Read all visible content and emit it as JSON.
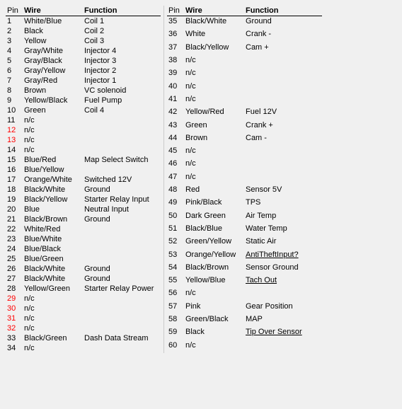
{
  "table_left": {
    "headers": [
      "Pin",
      "Wire",
      "Function"
    ],
    "rows": [
      {
        "pin": "1",
        "wire": "White/Blue",
        "function": "Coil 1",
        "pin_style": "",
        "function_style": ""
      },
      {
        "pin": "2",
        "wire": "Black",
        "function": "Coil 2",
        "pin_style": "",
        "function_style": ""
      },
      {
        "pin": "3",
        "wire": "Yellow",
        "function": "Coil 3",
        "pin_style": "",
        "function_style": ""
      },
      {
        "pin": "4",
        "wire": "Gray/White",
        "function": "Injector 4",
        "pin_style": "",
        "function_style": ""
      },
      {
        "pin": "5",
        "wire": "Gray/Black",
        "function": "Injector 3",
        "pin_style": "",
        "function_style": ""
      },
      {
        "pin": "6",
        "wire": "Gray/Yellow",
        "function": "Injector 2",
        "pin_style": "",
        "function_style": ""
      },
      {
        "pin": "7",
        "wire": "Gray/Red",
        "function": "Injector 1",
        "pin_style": "",
        "function_style": ""
      },
      {
        "pin": "8",
        "wire": "Brown",
        "function": "VC solenoid",
        "pin_style": "",
        "function_style": ""
      },
      {
        "pin": "9",
        "wire": "Yellow/Black",
        "function": "Fuel Pump",
        "pin_style": "",
        "function_style": ""
      },
      {
        "pin": "10",
        "wire": "Green",
        "function": "Coil 4",
        "pin_style": "",
        "function_style": ""
      },
      {
        "pin": "11",
        "wire": "n/c",
        "function": "",
        "pin_style": "",
        "function_style": ""
      },
      {
        "pin": "12",
        "wire": "n/c",
        "function": "",
        "pin_style": "red",
        "function_style": ""
      },
      {
        "pin": "13",
        "wire": "n/c",
        "function": "",
        "pin_style": "red",
        "function_style": ""
      },
      {
        "pin": "14",
        "wire": "n/c",
        "function": "",
        "pin_style": "",
        "function_style": ""
      },
      {
        "pin": "15",
        "wire": "Blue/Red",
        "function": "Map Select Switch",
        "pin_style": "",
        "function_style": ""
      },
      {
        "pin": "16",
        "wire": "Blue/Yellow",
        "function": "",
        "pin_style": "",
        "function_style": ""
      },
      {
        "pin": "17",
        "wire": "Orange/White",
        "function": "Switched 12V",
        "pin_style": "",
        "function_style": ""
      },
      {
        "pin": "18",
        "wire": "Black/White",
        "function": "Ground",
        "pin_style": "",
        "function_style": ""
      },
      {
        "pin": "19",
        "wire": "Black/Yellow",
        "function": "Starter Relay Input",
        "pin_style": "",
        "function_style": ""
      },
      {
        "pin": "20",
        "wire": "Blue",
        "function": "Neutral Input",
        "pin_style": "",
        "function_style": ""
      },
      {
        "pin": "21",
        "wire": "Black/Brown",
        "function": "Ground",
        "pin_style": "",
        "function_style": ""
      },
      {
        "pin": "22",
        "wire": "White/Red",
        "function": "",
        "pin_style": "",
        "function_style": ""
      },
      {
        "pin": "23",
        "wire": "Blue/White",
        "function": "",
        "pin_style": "",
        "function_style": ""
      },
      {
        "pin": "24",
        "wire": "Blue/Black",
        "function": "",
        "pin_style": "",
        "function_style": ""
      },
      {
        "pin": "25",
        "wire": "Blue/Green",
        "function": "",
        "pin_style": "",
        "function_style": ""
      },
      {
        "pin": "26",
        "wire": "Black/White",
        "function": "Ground",
        "pin_style": "",
        "function_style": ""
      },
      {
        "pin": "27",
        "wire": "Black/White",
        "function": "Ground",
        "pin_style": "",
        "function_style": ""
      },
      {
        "pin": "28",
        "wire": "Yellow/Green",
        "function": "Starter Relay Power",
        "pin_style": "",
        "function_style": ""
      },
      {
        "pin": "29",
        "wire": "n/c",
        "function": "",
        "pin_style": "red",
        "function_style": ""
      },
      {
        "pin": "30",
        "wire": "n/c",
        "function": "",
        "pin_style": "red",
        "function_style": ""
      },
      {
        "pin": "31",
        "wire": "n/c",
        "function": "",
        "pin_style": "red",
        "function_style": ""
      },
      {
        "pin": "32",
        "wire": "n/c",
        "function": "",
        "pin_style": "red",
        "function_style": ""
      },
      {
        "pin": "33",
        "wire": "Black/Green",
        "function": "Dash Data Stream",
        "pin_style": "",
        "function_style": ""
      },
      {
        "pin": "34",
        "wire": "n/c",
        "function": "",
        "pin_style": "",
        "function_style": ""
      }
    ]
  },
  "table_right": {
    "headers": [
      "Pin",
      "Wire",
      "Function"
    ],
    "rows": [
      {
        "pin": "35",
        "wire": "Black/White",
        "function": "Ground",
        "pin_style": "",
        "function_style": ""
      },
      {
        "pin": "36",
        "wire": "White",
        "function": "Crank -",
        "pin_style": "",
        "function_style": ""
      },
      {
        "pin": "37",
        "wire": "Black/Yellow",
        "function": "Cam +",
        "pin_style": "",
        "function_style": ""
      },
      {
        "pin": "38",
        "wire": "n/c",
        "function": "",
        "pin_style": "",
        "function_style": ""
      },
      {
        "pin": "39",
        "wire": "n/c",
        "function": "",
        "pin_style": "",
        "function_style": ""
      },
      {
        "pin": "40",
        "wire": "n/c",
        "function": "",
        "pin_style": "",
        "function_style": ""
      },
      {
        "pin": "41",
        "wire": "n/c",
        "function": "",
        "pin_style": "",
        "function_style": ""
      },
      {
        "pin": "42",
        "wire": "Yellow/Red",
        "function": "Fuel 12V",
        "pin_style": "",
        "function_style": ""
      },
      {
        "pin": "43",
        "wire": "Green",
        "function": "Crank +",
        "pin_style": "",
        "function_style": ""
      },
      {
        "pin": "44",
        "wire": "Brown",
        "function": "Cam -",
        "pin_style": "",
        "function_style": ""
      },
      {
        "pin": "45",
        "wire": "n/c",
        "function": "",
        "pin_style": "",
        "function_style": ""
      },
      {
        "pin": "46",
        "wire": "n/c",
        "function": "",
        "pin_style": "",
        "function_style": ""
      },
      {
        "pin": "47",
        "wire": "n/c",
        "function": "",
        "pin_style": "",
        "function_style": ""
      },
      {
        "pin": "48",
        "wire": "Red",
        "function": "Sensor 5V",
        "pin_style": "",
        "function_style": ""
      },
      {
        "pin": "49",
        "wire": "Pink/Black",
        "function": "TPS",
        "pin_style": "",
        "function_style": ""
      },
      {
        "pin": "50",
        "wire": "Dark Green",
        "function": "Air Temp",
        "pin_style": "",
        "function_style": ""
      },
      {
        "pin": "51",
        "wire": "Black/Blue",
        "function": "Water Temp",
        "pin_style": "",
        "function_style": ""
      },
      {
        "pin": "52",
        "wire": "Green/Yellow",
        "function": "Static Air",
        "pin_style": "",
        "function_style": ""
      },
      {
        "pin": "53",
        "wire": "Orange/Yellow",
        "function": "AntiTheftInput?",
        "pin_style": "",
        "function_style": "underline"
      },
      {
        "pin": "54",
        "wire": "Black/Brown",
        "function": "Sensor Ground",
        "pin_style": "",
        "function_style": ""
      },
      {
        "pin": "55",
        "wire": "Yellow/Blue",
        "function": "Tach Out",
        "pin_style": "",
        "function_style": "underline"
      },
      {
        "pin": "56",
        "wire": "n/c",
        "function": "",
        "pin_style": "",
        "function_style": ""
      },
      {
        "pin": "57",
        "wire": "Pink",
        "function": "Gear Position",
        "pin_style": "",
        "function_style": ""
      },
      {
        "pin": "58",
        "wire": "Green/Black",
        "function": "MAP",
        "pin_style": "",
        "function_style": ""
      },
      {
        "pin": "59",
        "wire": "Black",
        "function": "Tip Over Sensor",
        "pin_style": "",
        "function_style": "underline"
      },
      {
        "pin": "60",
        "wire": "n/c",
        "function": "",
        "pin_style": "",
        "function_style": ""
      }
    ]
  }
}
